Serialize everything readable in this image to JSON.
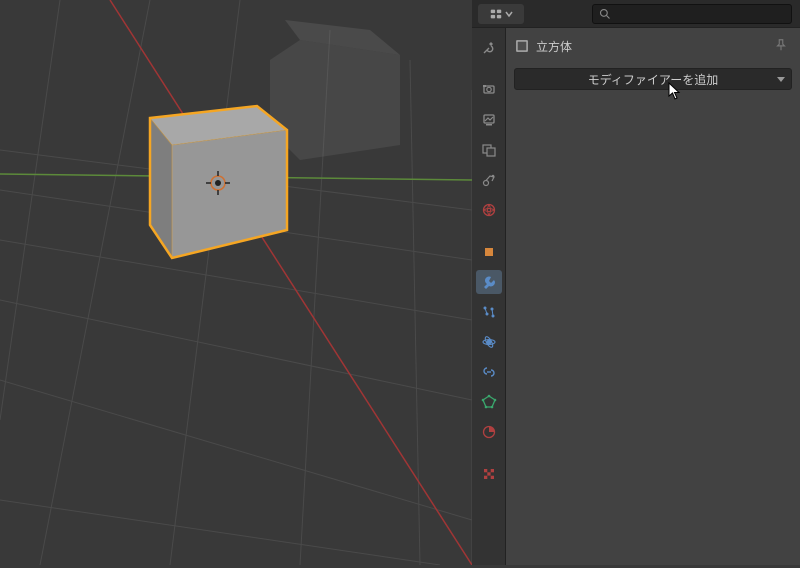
{
  "viewport": {
    "object_name": "立方体"
  },
  "panel": {
    "search_placeholder": "",
    "breadcrumb_object": "立方体",
    "add_modifier_label": "モディファイアーを追加"
  },
  "tabs": [
    {
      "name": "tool",
      "color": "#8a8a8a"
    },
    {
      "name": "render",
      "color": "#8a8a8a"
    },
    {
      "name": "output",
      "color": "#8a8a8a"
    },
    {
      "name": "view-layer",
      "color": "#8a8a8a"
    },
    {
      "name": "scene",
      "color": "#8a8a8a"
    },
    {
      "name": "world",
      "color": "#b04040"
    },
    {
      "name": "object",
      "color": "#d7873c"
    },
    {
      "name": "modifiers",
      "color": "#5a8cc8",
      "active": true
    },
    {
      "name": "particles",
      "color": "#5a8cc8"
    },
    {
      "name": "physics",
      "color": "#5a8cc8"
    },
    {
      "name": "constraints",
      "color": "#5a8cc8"
    },
    {
      "name": "mesh",
      "color": "#3aa76d"
    },
    {
      "name": "material",
      "color": "#b04040"
    },
    {
      "name": "texture",
      "color": "#b04040"
    }
  ],
  "colors": {
    "bg_dark": "#2a2a2a",
    "bg_mid": "#393939",
    "bg_panel": "#424242",
    "accent_modifier": "#5a8cc8",
    "cube_outline": "#f5a623"
  }
}
